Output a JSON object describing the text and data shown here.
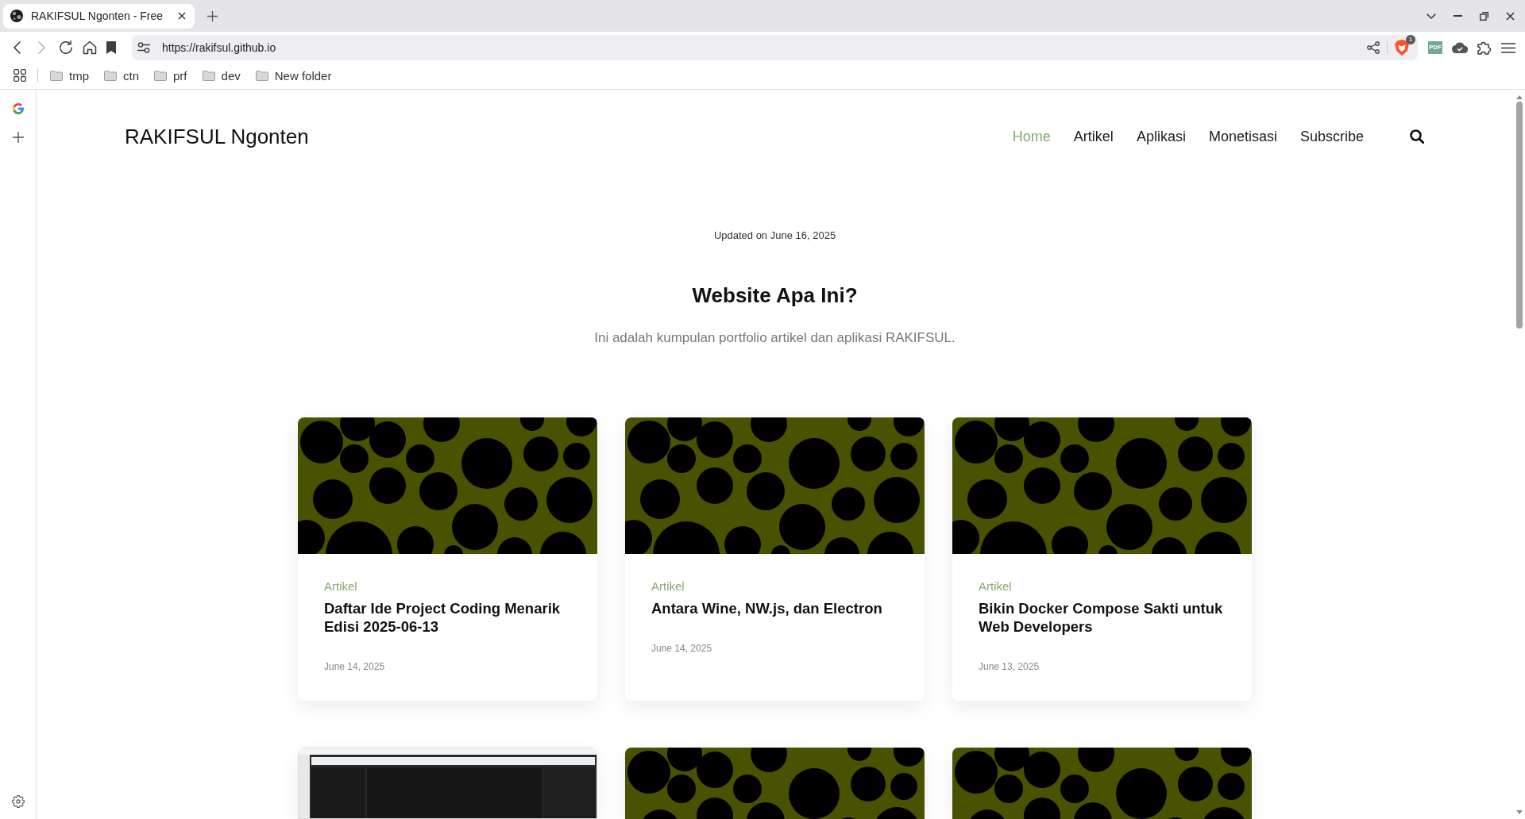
{
  "browser": {
    "tabs": [
      {
        "title": "RAKIFSUL Ngonten - Free",
        "selected": true
      }
    ],
    "back_disabled": false,
    "forward_disabled": true,
    "url": "https://rakifsul.github.io",
    "shield_badge": "1",
    "extension_label": "PDF",
    "bookmarks": [
      {
        "label": "tmp"
      },
      {
        "label": "ctn"
      },
      {
        "label": "prf"
      },
      {
        "label": "dev"
      },
      {
        "label": "New folder"
      }
    ]
  },
  "site": {
    "logo": "RAKIFSUL Ngonten",
    "nav": [
      {
        "label": "Home",
        "selected": true
      },
      {
        "label": "Artikel",
        "selected": false
      },
      {
        "label": "Aplikasi",
        "selected": false
      },
      {
        "label": "Monetisasi",
        "selected": false
      },
      {
        "label": "Subscribe",
        "selected": false
      }
    ]
  },
  "intro": {
    "updated": "Updated on June 16, 2025",
    "heading": "Website Apa Ini?",
    "description": "Ini adalah kumpulan portfolio artikel dan aplikasi RAKIFSUL."
  },
  "posts": [
    {
      "kind": "pattern",
      "category": "Artikel",
      "title": "Daftar Ide Project Coding Menarik Edisi 2025-06-13",
      "date": "June 14, 2025"
    },
    {
      "kind": "pattern",
      "category": "Artikel",
      "title": "Antara Wine, NW.js, dan Electron",
      "date": "June 14, 2025"
    },
    {
      "kind": "pattern",
      "category": "Artikel",
      "title": "Bikin Docker Compose Sakti untuk Web Developers",
      "date": "June 13, 2025"
    },
    {
      "kind": "screenshot"
    },
    {
      "kind": "pattern"
    },
    {
      "kind": "pattern"
    }
  ]
}
